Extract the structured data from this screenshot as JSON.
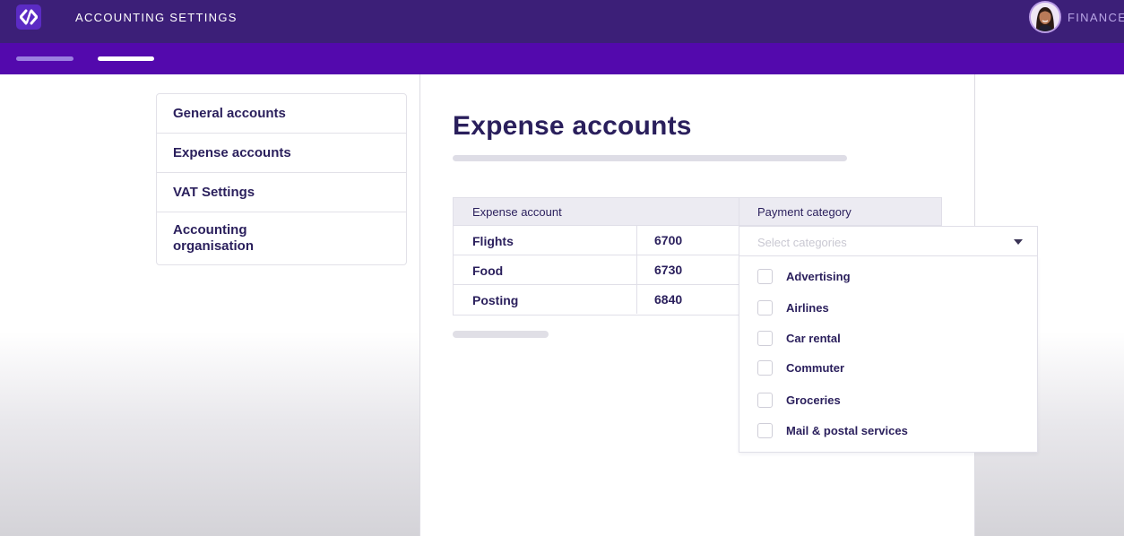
{
  "header": {
    "app_title": "ACCOUNTING SETTINGS",
    "org_name": "FINANCE",
    "logo_icon": "brand-logo-icon",
    "avatar_icon": "user-avatar"
  },
  "colors": {
    "header_bg": "#3c1f78",
    "tabstrip_bg": "#5309ad",
    "text_primary": "#2a1f5c"
  },
  "sidebar": {
    "items": [
      {
        "label": "General accounts"
      },
      {
        "label": "Expense accounts"
      },
      {
        "label": "VAT Settings"
      },
      {
        "label": "Accounting organisation"
      }
    ]
  },
  "main": {
    "title": "Expense accounts",
    "table": {
      "headers": {
        "account": "Expense account",
        "category": "Payment category"
      },
      "rows": [
        {
          "name": "Flights",
          "code": "6700"
        },
        {
          "name": "Food",
          "code": "6730"
        },
        {
          "name": "Posting",
          "code": "6840"
        }
      ]
    },
    "category_select": {
      "placeholder": "Select categories",
      "options": [
        {
          "label": "Advertising",
          "checked": false
        },
        {
          "label": "Airlines",
          "checked": false
        },
        {
          "label": "Car rental",
          "checked": false
        },
        {
          "label": "Commuter",
          "checked": false
        },
        {
          "label": "Groceries",
          "checked": false
        },
        {
          "label": "Mail & postal services",
          "checked": false
        }
      ]
    }
  }
}
